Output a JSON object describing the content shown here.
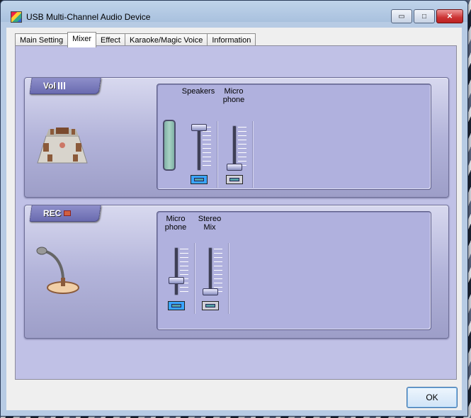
{
  "window": {
    "title": "USB Multi-Channel Audio Device"
  },
  "caption": {
    "minimize": "▭",
    "maximize": "□",
    "close": "✕"
  },
  "tabs": [
    {
      "label": "Main Setting"
    },
    {
      "label": "Mixer",
      "active": true
    },
    {
      "label": "Effect"
    },
    {
      "label": "Karaoke/Magic Voice"
    },
    {
      "label": "Information"
    }
  ],
  "volume": {
    "ribbon": "Vol",
    "channels": [
      {
        "label": "Speakers",
        "level": 0.92,
        "muted": true
      },
      {
        "label": "Micro\nphone",
        "level": 0.05,
        "muted": false
      }
    ]
  },
  "record": {
    "ribbon": "REC",
    "channels": [
      {
        "label": "Micro\nphone",
        "level": 0.3,
        "muted": true
      },
      {
        "label": "Stereo\nMix",
        "level": 0.05,
        "muted": false
      }
    ]
  },
  "ok_label": "OK"
}
